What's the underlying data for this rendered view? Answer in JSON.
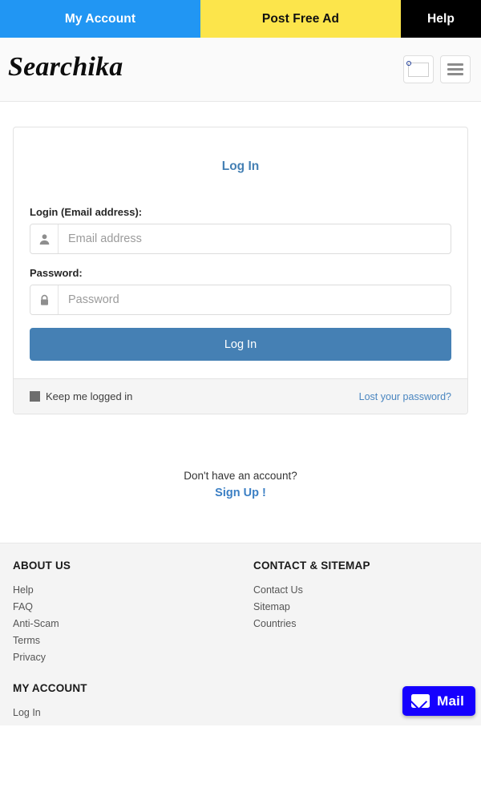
{
  "topnav": {
    "items": [
      {
        "label": "My Account",
        "bg": "#2196f3",
        "fg": "#ffffff"
      },
      {
        "label": "Post Free Ad",
        "bg": "#fce54b",
        "fg": "#111111"
      },
      {
        "label": "Help",
        "bg": "#000000",
        "fg": "#ffffff"
      }
    ]
  },
  "header": {
    "logo": "Searchika",
    "flag_icon": "india-flag-icon",
    "menu_icon": "hamburger-menu-icon"
  },
  "login_card": {
    "title": "Log In",
    "email": {
      "label": "Login (Email address):",
      "placeholder": "Email address",
      "value": "",
      "icon": "user-icon"
    },
    "password": {
      "label": "Password:",
      "placeholder": "Password",
      "value": "",
      "icon": "lock-icon"
    },
    "submit_label": "Log In",
    "keep_logged_in_label": "Keep me logged in",
    "keep_logged_in_checked": false,
    "lost_password_label": "Lost your password?"
  },
  "signup": {
    "question": "Don't have an account?",
    "action": "Sign Up !"
  },
  "footer": {
    "about": {
      "heading": "ABOUT US",
      "links": [
        "Help",
        "FAQ",
        "Anti-Scam",
        "Terms",
        "Privacy"
      ]
    },
    "contact": {
      "heading": "CONTACT & SITEMAP",
      "links": [
        "Contact Us",
        "Sitemap",
        "Countries"
      ]
    },
    "account": {
      "heading": "MY ACCOUNT",
      "links": [
        "Log In"
      ]
    }
  },
  "mail_fab": {
    "label": "Mail",
    "icon": "envelope-icon",
    "color": "#1500ff"
  },
  "colors": {
    "nav_blue": "#2196f3",
    "nav_yellow": "#fce54b",
    "nav_black": "#000000",
    "primary_button": "#4580b4",
    "link": "#4a86c0",
    "footer_bg": "#f4f4f4"
  }
}
